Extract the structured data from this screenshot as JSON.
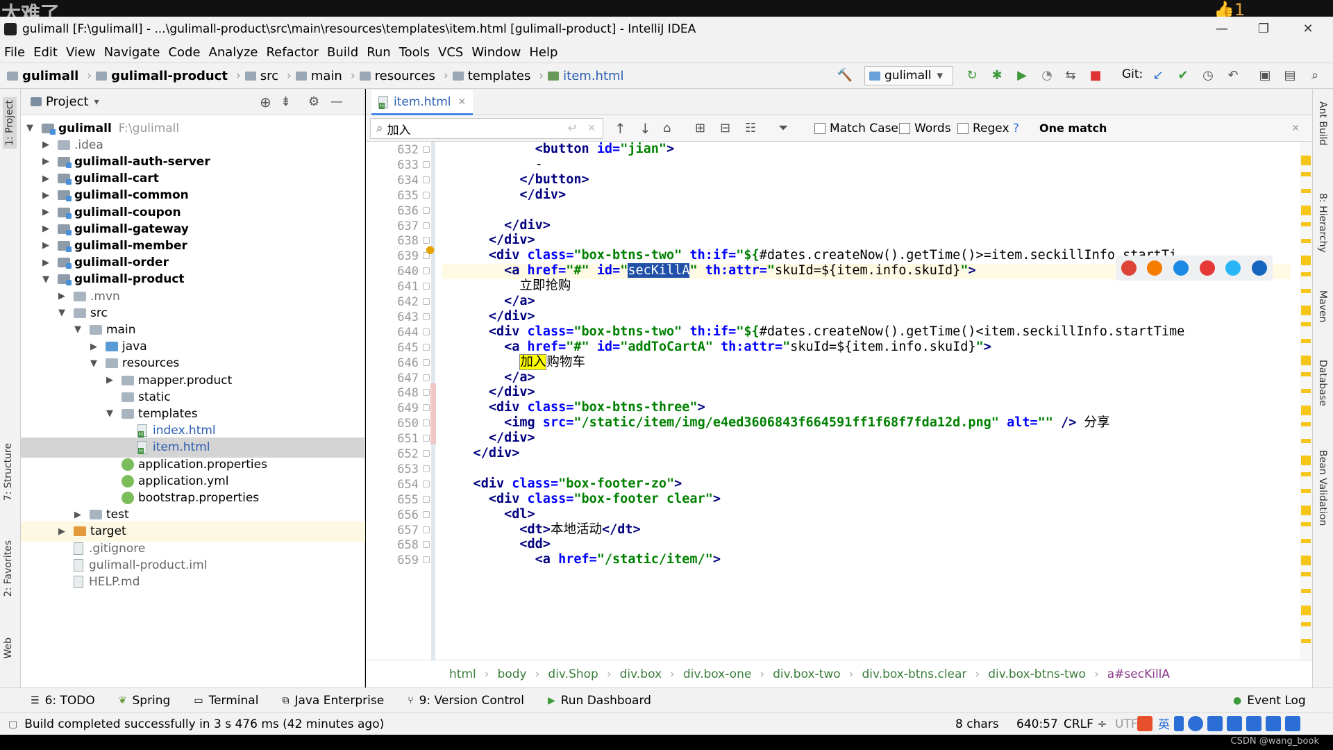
{
  "overlay": {
    "watermark": "太难了",
    "like_count": "1",
    "credit": "CSDN @wang_book"
  },
  "window": {
    "title": "gulimall [F:\\gulimall] - ...\\gulimall-product\\src\\main\\resources\\templates\\item.html [gulimall-product] - IntelliJ IDEA"
  },
  "menu": [
    "File",
    "Edit",
    "View",
    "Navigate",
    "Code",
    "Analyze",
    "Refactor",
    "Build",
    "Run",
    "Tools",
    "VCS",
    "Window",
    "Help"
  ],
  "nav": {
    "crumbs": [
      "gulimall",
      "gulimall-product",
      "src",
      "main",
      "resources",
      "templates",
      "item.html"
    ],
    "run_config": "gulimall",
    "git_label": "Git:"
  },
  "project": {
    "header": "Project",
    "root": {
      "name": "gulimall",
      "path": "F:\\gulimall"
    },
    "rows": [
      {
        "label": "gulimall",
        "hint": "F:\\gulimall",
        "level": 0,
        "arrow": "open",
        "icon": "module",
        "bold": true
      },
      {
        "label": ".idea",
        "level": 1,
        "arrow": "closed",
        "icon": "folder",
        "muted": true
      },
      {
        "label": "gulimall-auth-server",
        "level": 1,
        "arrow": "closed",
        "icon": "module",
        "bold": true
      },
      {
        "label": "gulimall-cart",
        "level": 1,
        "arrow": "closed",
        "icon": "module",
        "bold": true
      },
      {
        "label": "gulimall-common",
        "level": 1,
        "arrow": "closed",
        "icon": "module",
        "bold": true
      },
      {
        "label": "gulimall-coupon",
        "level": 1,
        "arrow": "closed",
        "icon": "module",
        "bold": true
      },
      {
        "label": "gulimall-gateway",
        "level": 1,
        "arrow": "closed",
        "icon": "module",
        "bold": true
      },
      {
        "label": "gulimall-member",
        "level": 1,
        "arrow": "closed",
        "icon": "module",
        "bold": true
      },
      {
        "label": "gulimall-order",
        "level": 1,
        "arrow": "closed",
        "icon": "module",
        "bold": true
      },
      {
        "label": "gulimall-product",
        "level": 1,
        "arrow": "open",
        "icon": "module",
        "bold": true
      },
      {
        "label": ".mvn",
        "level": 2,
        "arrow": "closed",
        "icon": "folder",
        "muted": true
      },
      {
        "label": "src",
        "level": 2,
        "arrow": "open",
        "icon": "folder"
      },
      {
        "label": "main",
        "level": 3,
        "arrow": "open",
        "icon": "folder"
      },
      {
        "label": "java",
        "level": 4,
        "arrow": "closed",
        "icon": "folder-blue"
      },
      {
        "label": "resources",
        "level": 4,
        "arrow": "open",
        "icon": "folder"
      },
      {
        "label": "mapper.product",
        "level": 5,
        "arrow": "closed",
        "icon": "folder"
      },
      {
        "label": "static",
        "level": 5,
        "arrow": "none",
        "icon": "folder"
      },
      {
        "label": "templates",
        "level": 5,
        "arrow": "open",
        "icon": "folder"
      },
      {
        "label": "index.html",
        "level": 6,
        "arrow": "none",
        "icon": "html",
        "blue": true
      },
      {
        "label": "item.html",
        "level": 6,
        "arrow": "none",
        "icon": "html",
        "blue": true,
        "selected": true
      },
      {
        "label": "application.properties",
        "level": 5,
        "arrow": "none",
        "icon": "leaf"
      },
      {
        "label": "application.yml",
        "level": 5,
        "arrow": "none",
        "icon": "leaf"
      },
      {
        "label": "bootstrap.properties",
        "level": 5,
        "arrow": "none",
        "icon": "leaf"
      },
      {
        "label": "test",
        "level": 3,
        "arrow": "closed",
        "icon": "folder"
      },
      {
        "label": "target",
        "level": 2,
        "arrow": "closed",
        "icon": "folder-orange",
        "highlight": true
      },
      {
        "label": ".gitignore",
        "level": 2,
        "arrow": "none",
        "icon": "file",
        "muted": true
      },
      {
        "label": "gulimall-product.iml",
        "level": 2,
        "arrow": "none",
        "icon": "file",
        "muted": true
      },
      {
        "label": "HELP.md",
        "level": 2,
        "arrow": "none",
        "icon": "file",
        "muted": true
      }
    ]
  },
  "editor": {
    "tab": "item.html",
    "find": {
      "query": "加入",
      "match_case": "Match Case",
      "words": "Words",
      "regex": "Regex",
      "help": "?",
      "result": "One match"
    },
    "line_numbers": [
      "632",
      "633",
      "634",
      "635",
      "636",
      "637",
      "638",
      "639",
      "640",
      "641",
      "642",
      "643",
      "644",
      "645",
      "646",
      "647",
      "648",
      "649",
      "650",
      "651",
      "652",
      "653",
      "654",
      "655",
      "656",
      "657",
      "658",
      "659"
    ],
    "lines": [
      [
        {
          "c": "tg",
          "t": "            <button "
        },
        {
          "c": "at",
          "t": "id="
        },
        {
          "c": "sv",
          "t": "\"jian\""
        },
        {
          "c": "tg",
          "t": ">"
        }
      ],
      [
        {
          "c": "tx",
          "t": "            -"
        }
      ],
      [
        {
          "c": "tg",
          "t": "          </button>"
        }
      ],
      [
        {
          "c": "tg",
          "t": "          </div>"
        }
      ],
      [
        {
          "c": "tx",
          "t": ""
        }
      ],
      [
        {
          "c": "tg",
          "t": "        </div>"
        }
      ],
      [
        {
          "c": "tg",
          "t": "      </div>"
        }
      ],
      [
        {
          "c": "tg",
          "t": "      <div "
        },
        {
          "c": "at",
          "t": "class="
        },
        {
          "c": "sv",
          "t": "\"box-btns-two\""
        },
        {
          "c": "tx",
          "t": " "
        },
        {
          "c": "at",
          "t": "th:if="
        },
        {
          "c": "sv",
          "t": "\"${"
        },
        {
          "c": "tx",
          "t": "#dates.createNow().getTime()>=item.seckillInfo.startTi"
        }
      ],
      [
        {
          "c": "tg",
          "t": "        <a "
        },
        {
          "c": "at",
          "t": "href="
        },
        {
          "c": "sv",
          "t": "\"#\""
        },
        {
          "c": "tx",
          "t": " "
        },
        {
          "c": "at",
          "t": "id="
        },
        {
          "c": "sv",
          "t": "\""
        },
        {
          "c": "sel",
          "t": "secKillA"
        },
        {
          "c": "sv",
          "t": "\""
        },
        {
          "c": "tx",
          "t": " "
        },
        {
          "c": "at",
          "t": "th:attr="
        },
        {
          "c": "sv",
          "t": "\""
        },
        {
          "c": "tx",
          "t": "skuId=${item.info.skuId}"
        },
        {
          "c": "sv",
          "t": "\""
        },
        {
          "c": "tg",
          "t": ">"
        }
      ],
      [
        {
          "c": "tx",
          "t": "          立即抢购"
        }
      ],
      [
        {
          "c": "tg",
          "t": "        </a>"
        }
      ],
      [
        {
          "c": "tg",
          "t": "      </div>"
        }
      ],
      [
        {
          "c": "tg",
          "t": "      <div "
        },
        {
          "c": "at",
          "t": "class="
        },
        {
          "c": "sv",
          "t": "\"box-btns-two\""
        },
        {
          "c": "tx",
          "t": " "
        },
        {
          "c": "at",
          "t": "th:if="
        },
        {
          "c": "sv",
          "t": "\"${"
        },
        {
          "c": "tx",
          "t": "#dates.createNow().getTime()<item.seckillInfo.startTime"
        }
      ],
      [
        {
          "c": "tg",
          "t": "        <a "
        },
        {
          "c": "at",
          "t": "href="
        },
        {
          "c": "sv",
          "t": "\"#\""
        },
        {
          "c": "tx",
          "t": " "
        },
        {
          "c": "at",
          "t": "id="
        },
        {
          "c": "sv",
          "t": "\"addToCartA\""
        },
        {
          "c": "tx",
          "t": " "
        },
        {
          "c": "at",
          "t": "th:attr="
        },
        {
          "c": "sv",
          "t": "\""
        },
        {
          "c": "tx",
          "t": "skuId=${item.info.skuId}"
        },
        {
          "c": "sv",
          "t": "\""
        },
        {
          "c": "tg",
          "t": ">"
        }
      ],
      [
        {
          "c": "tx",
          "t": "          "
        },
        {
          "c": "hl",
          "t": "加入"
        },
        {
          "c": "tx",
          "t": "购物车"
        }
      ],
      [
        {
          "c": "tg",
          "t": "        </a>"
        }
      ],
      [
        {
          "c": "tg",
          "t": "      </div>"
        }
      ],
      [
        {
          "c": "tg",
          "t": "      <div "
        },
        {
          "c": "at",
          "t": "class="
        },
        {
          "c": "sv",
          "t": "\"box-btns-three\""
        },
        {
          "c": "tg",
          "t": ">"
        }
      ],
      [
        {
          "c": "tg",
          "t": "        <img "
        },
        {
          "c": "at",
          "t": "src="
        },
        {
          "c": "sv",
          "t": "\"/static/item/img/e4ed3606843f664591ff1f68f7fda12d.png\""
        },
        {
          "c": "tx",
          "t": " "
        },
        {
          "c": "at",
          "t": "alt="
        },
        {
          "c": "sv",
          "t": "\"\""
        },
        {
          "c": "tg",
          "t": " />"
        },
        {
          "c": "tx",
          "t": " 分享"
        }
      ],
      [
        {
          "c": "tg",
          "t": "      </div>"
        }
      ],
      [
        {
          "c": "tg",
          "t": "    </div>"
        }
      ],
      [
        {
          "c": "tx",
          "t": ""
        }
      ],
      [
        {
          "c": "tg",
          "t": "    <div "
        },
        {
          "c": "at",
          "t": "class="
        },
        {
          "c": "sv",
          "t": "\"box-footer-zo\""
        },
        {
          "c": "tg",
          "t": ">"
        }
      ],
      [
        {
          "c": "tg",
          "t": "      <div "
        },
        {
          "c": "at",
          "t": "class="
        },
        {
          "c": "sv",
          "t": "\"box-footer clear\""
        },
        {
          "c": "tg",
          "t": ">"
        }
      ],
      [
        {
          "c": "tg",
          "t": "        <dl>"
        }
      ],
      [
        {
          "c": "tg",
          "t": "          <dt>"
        },
        {
          "c": "tx",
          "t": "本地活动"
        },
        {
          "c": "tg",
          "t": "</dt>"
        }
      ],
      [
        {
          "c": "tg",
          "t": "          <dd>"
        }
      ],
      [
        {
          "c": "tg",
          "t": "            <a "
        },
        {
          "c": "at",
          "t": "href="
        },
        {
          "c": "sv",
          "t": "\"/static/item/\""
        },
        {
          "c": "tg",
          "t": ">"
        }
      ]
    ],
    "breadcrumb": [
      "html",
      "body",
      "div.Shop",
      "div.box",
      "div.box-one",
      "div.box-two",
      "div.box-btns.clear",
      "div.box-btns-two",
      "a#secKillA"
    ]
  },
  "left_tools": [
    "1: Project",
    "7: Structure",
    "2: Favorites",
    "Web"
  ],
  "right_tools": [
    "Ant Build",
    "8: Hierarchy",
    "Maven",
    "Database",
    "Bean Validation"
  ],
  "tool_windows": [
    "6: TODO",
    "Spring",
    "Terminal",
    "Java Enterprise",
    "9: Version Control",
    "Run Dashboard",
    "Event Log"
  ],
  "status": {
    "message": "Build completed successfully in 3 s 476 ms (42 minutes ago)",
    "chars": "8 chars",
    "position": "640:57",
    "line_sep": "CRLF",
    "encoding": "UTF",
    "ime": "英"
  },
  "colors": {
    "accent": "#4a86e8",
    "tag": "#000080",
    "attr": "#0000ff",
    "string": "#008000"
  }
}
